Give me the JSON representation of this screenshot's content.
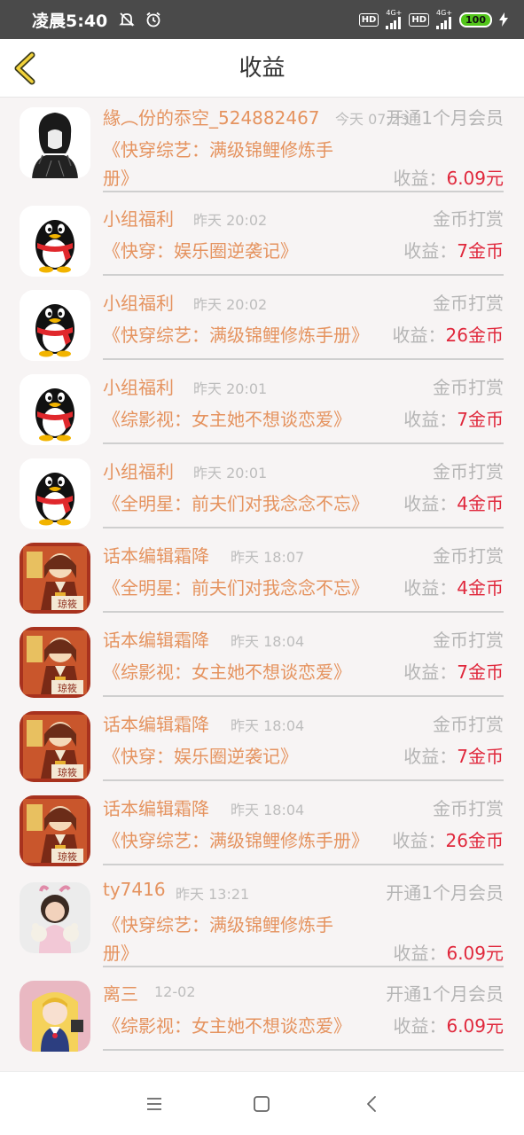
{
  "status_bar": {
    "time": "凌晨5:40",
    "hd1": "HD",
    "net1": "4G+",
    "hd2": "HD",
    "net2": "4G+",
    "battery": "100"
  },
  "header": {
    "title": "收益"
  },
  "earn_label": "收益：",
  "items": [
    {
      "user": "緣︵份的忝空_524882467",
      "time": "今天 07:23",
      "type": "开通1个月会员",
      "book_line1": "《快穿综艺：满级锦鲤修炼手",
      "book_line2": "册》",
      "amount": "6.09元",
      "avatar": "sketch"
    },
    {
      "user": "小组福利",
      "time": "昨天 20:02",
      "type": "金币打赏",
      "book_line1": "《快穿：娱乐圈逆袭记》",
      "book_line2": "",
      "amount": "7金币",
      "avatar": "penguin"
    },
    {
      "user": "小组福利",
      "time": "昨天 20:02",
      "type": "金币打赏",
      "book_line1": "《快穿综艺：满级锦鲤修炼手册》",
      "book_line2": "",
      "amount": "26金币",
      "avatar": "penguin"
    },
    {
      "user": "小组福利",
      "time": "昨天 20:01",
      "type": "金币打赏",
      "book_line1": "《综影视：女主她不想谈恋爱》",
      "book_line2": "",
      "amount": "7金币",
      "avatar": "penguin"
    },
    {
      "user": "小组福利",
      "time": "昨天 20:01",
      "type": "金币打赏",
      "book_line1": "《全明星：前夫们对我念念不忘》",
      "book_line2": "",
      "amount": "4金币",
      "avatar": "penguin"
    },
    {
      "user": "话本编辑霜降",
      "time": "昨天 18:07",
      "type": "金币打赏",
      "book_line1": "《全明星：前夫们对我念念不忘》",
      "book_line2": "",
      "amount": "4金币",
      "avatar": "anime"
    },
    {
      "user": "话本编辑霜降",
      "time": "昨天 18:04",
      "type": "金币打赏",
      "book_line1": "《综影视：女主她不想谈恋爱》",
      "book_line2": "",
      "amount": "7金币",
      "avatar": "anime"
    },
    {
      "user": "话本编辑霜降",
      "time": "昨天 18:04",
      "type": "金币打赏",
      "book_line1": "《快穿：娱乐圈逆袭记》",
      "book_line2": "",
      "amount": "7金币",
      "avatar": "anime"
    },
    {
      "user": "话本编辑霜降",
      "time": "昨天 18:04",
      "type": "金币打赏",
      "book_line1": "《快穿综艺：满级锦鲤修炼手册》",
      "book_line2": "",
      "amount": "26金币",
      "avatar": "anime"
    },
    {
      "user": "ty7416",
      "time": "昨天 13:21",
      "type": "开通1个月会员",
      "book_line1": "《快穿综艺：满级锦鲤修炼手",
      "book_line2": "册》",
      "amount": "6.09元",
      "avatar": "girl"
    },
    {
      "user": "离三",
      "time": "12-02",
      "type": "开通1个月会员",
      "book_line1": "《综影视：女主她不想谈恋爱》",
      "book_line2": "",
      "amount": "6.09元",
      "avatar": "sailor"
    }
  ]
}
